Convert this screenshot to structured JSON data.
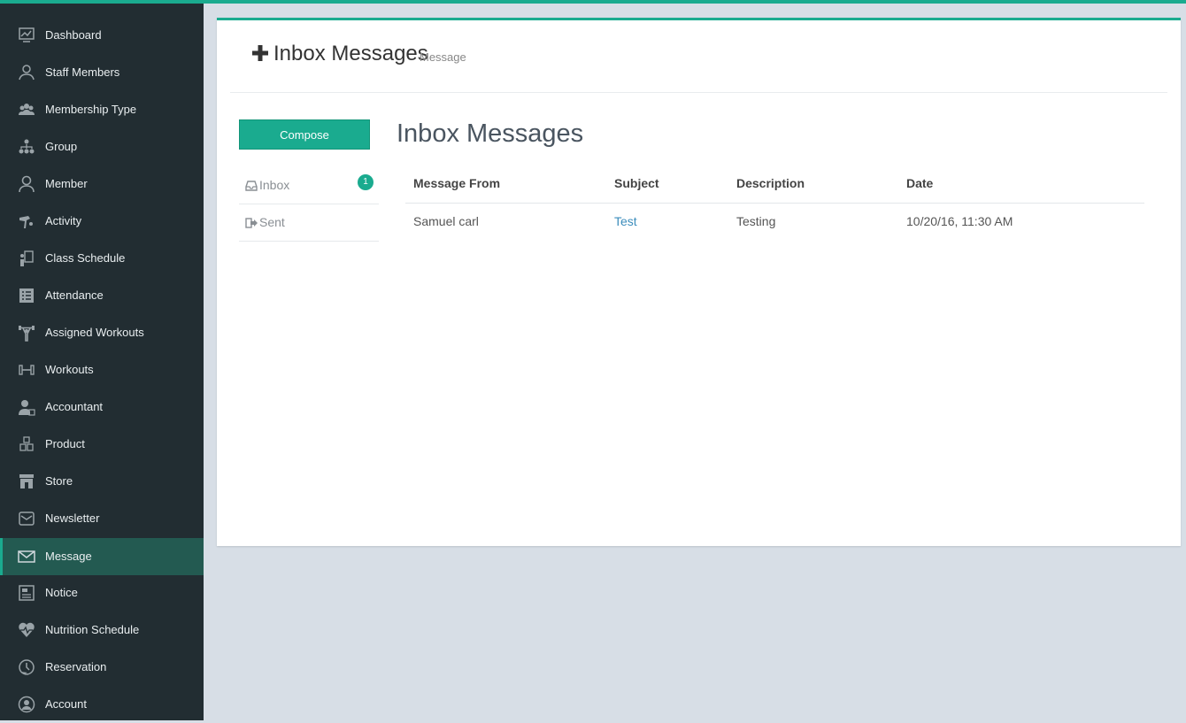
{
  "sidebar": {
    "items": [
      {
        "label": "Dashboard",
        "icon": "dashboard-icon"
      },
      {
        "label": "Staff Members",
        "icon": "staff-icon"
      },
      {
        "label": "Membership Type",
        "icon": "group-users-icon"
      },
      {
        "label": "Group",
        "icon": "hierarchy-icon"
      },
      {
        "label": "Member",
        "icon": "member-icon"
      },
      {
        "label": "Activity",
        "icon": "activity-icon"
      },
      {
        "label": "Class Schedule",
        "icon": "class-schedule-icon"
      },
      {
        "label": "Attendance",
        "icon": "attendance-icon"
      },
      {
        "label": "Assigned Workouts",
        "icon": "weightlifter-icon"
      },
      {
        "label": "Workouts",
        "icon": "dumbbell-icon"
      },
      {
        "label": "Accountant",
        "icon": "accountant-icon"
      },
      {
        "label": "Product",
        "icon": "boxes-icon"
      },
      {
        "label": "Store",
        "icon": "store-icon"
      },
      {
        "label": "Newsletter",
        "icon": "newsletter-icon"
      },
      {
        "label": "Message",
        "icon": "envelope-icon"
      },
      {
        "label": "Notice",
        "icon": "notice-icon"
      },
      {
        "label": "Nutrition Schedule",
        "icon": "heart-pulse-icon"
      },
      {
        "label": "Reservation",
        "icon": "reservation-icon"
      },
      {
        "label": "Account",
        "icon": "account-icon"
      }
    ],
    "active_index": 14
  },
  "header": {
    "title": "Inbox Messages",
    "subtitle": "Message"
  },
  "mailbox": {
    "compose_label": "Compose",
    "folders": [
      {
        "label": "Inbox",
        "count": "1"
      },
      {
        "label": "Sent"
      }
    ]
  },
  "main": {
    "title": "Inbox Messages",
    "columns": [
      "Message From",
      "Subject",
      "Description",
      "Date"
    ],
    "rows": [
      {
        "from": "Samuel carl",
        "subject": "Test",
        "description": "Testing",
        "date": "10/20/16, 11:30 AM"
      }
    ]
  },
  "colors": {
    "accent": "#1aab8f",
    "sidebar": "#222d32",
    "active": "#235a51",
    "link": "#3c8dbc"
  }
}
